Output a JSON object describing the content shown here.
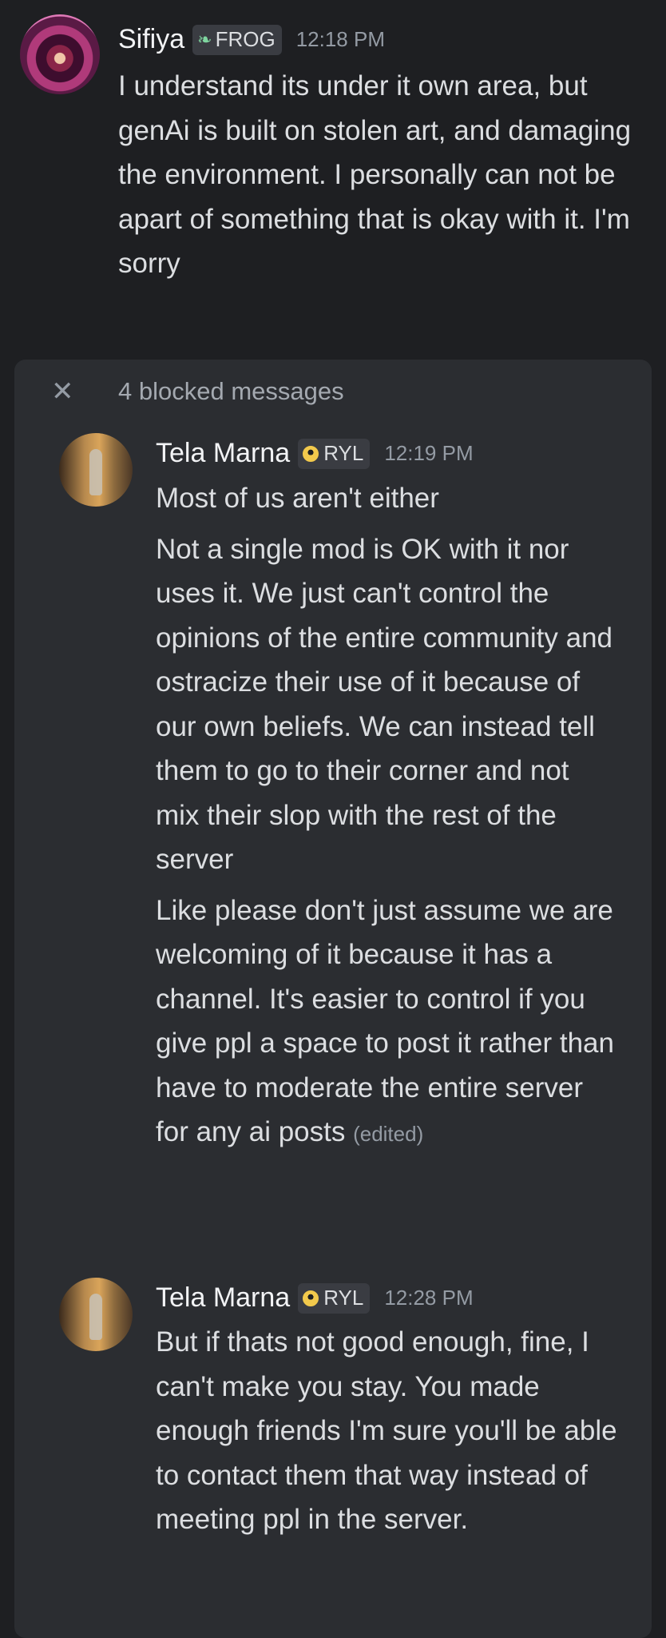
{
  "messages": [
    {
      "author": "Sifiya",
      "tag": "FROG",
      "tag_icon": "leaf-icon",
      "time": "12:18 PM",
      "paragraphs": [
        "I understand its under it own area, but genAi is built on stolen art, and damaging the environment. I personally can not be apart of something that is okay with it. I'm sorry"
      ]
    }
  ],
  "blocked": {
    "label": "4 blocked messages",
    "close_icon": "close-icon",
    "messages": [
      {
        "author": "Tela Marna",
        "tag": "RYL",
        "tag_icon": "ring-icon",
        "time": "12:19 PM",
        "paragraphs": [
          "Most of us aren't either",
          "Not a single mod is OK with it nor uses it. We just can't control the opinions of the entire community and ostracize their use of it because of our own beliefs. We can instead tell them to go to their corner and not mix their slop with the rest of the server",
          "Like please don't just assume we are welcoming of it because it has a channel. It's easier to control if you give ppl a space to post it rather than have to moderate the entire server for any ai posts"
        ],
        "edited": "(edited)"
      },
      {
        "author": "Tela Marna",
        "tag": "RYL",
        "tag_icon": "ring-icon",
        "time": "12:28 PM",
        "paragraphs": [
          "But if thats not good enough, fine, I can't make you stay. You made enough friends I'm sure you'll be able to contact them that way instead of meeting ppl in the server."
        ]
      }
    ]
  },
  "colors": {
    "background": "#1e1f22",
    "panel": "#2b2d31",
    "text": "#dcdee1",
    "muted": "#949ba4"
  }
}
